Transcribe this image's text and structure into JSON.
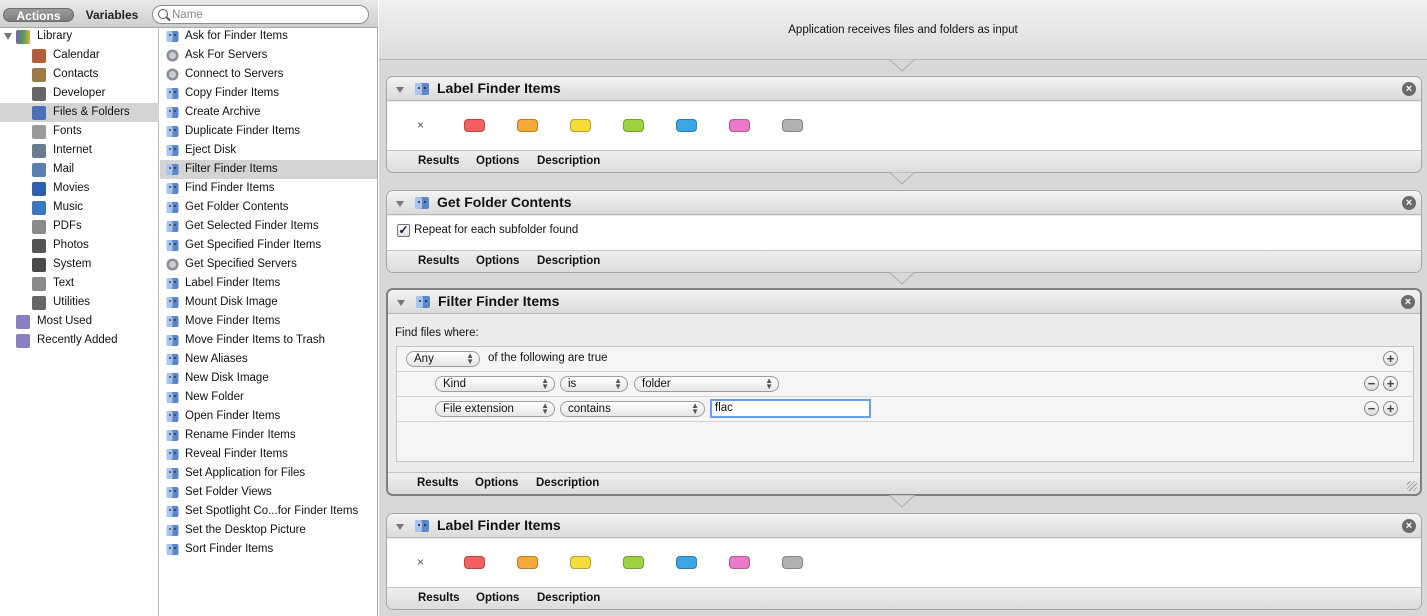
{
  "toolbar": {
    "actions_tab": "Actions",
    "variables_tab": "Variables",
    "search_placeholder": "Name"
  },
  "library": {
    "root": "Library",
    "items": [
      {
        "label": "Calendar",
        "icon": "calendar-icon",
        "color": "#b35f3a"
      },
      {
        "label": "Contacts",
        "icon": "contacts-icon",
        "color": "#9c7a4a"
      },
      {
        "label": "Developer",
        "icon": "tools-icon",
        "color": "#666666"
      },
      {
        "label": "Files & Folders",
        "icon": "finder-icon",
        "color": "#4a70b8"
      },
      {
        "label": "Fonts",
        "icon": "fonts-icon",
        "color": "#9a9a9a"
      },
      {
        "label": "Internet",
        "icon": "globe-icon",
        "color": "#6a7c90"
      },
      {
        "label": "Mail",
        "icon": "mail-icon",
        "color": "#5a7fb0"
      },
      {
        "label": "Movies",
        "icon": "quicktime-icon",
        "color": "#2f5fb0"
      },
      {
        "label": "Music",
        "icon": "itunes-icon",
        "color": "#3a76c4"
      },
      {
        "label": "PDFs",
        "icon": "pdf-icon",
        "color": "#8a8a8a"
      },
      {
        "label": "Photos",
        "icon": "camera-icon",
        "color": "#555555"
      },
      {
        "label": "System",
        "icon": "system-icon",
        "color": "#4a4a4a"
      },
      {
        "label": "Text",
        "icon": "text-icon",
        "color": "#8a8a8a"
      },
      {
        "label": "Utilities",
        "icon": "tools-icon",
        "color": "#666666"
      }
    ],
    "smart_groups": [
      {
        "label": "Most Used",
        "icon": "smart-folder-icon",
        "color": "#8b7fc4"
      },
      {
        "label": "Recently Added",
        "icon": "smart-folder-icon",
        "color": "#8b7fc4"
      }
    ],
    "selected": "Files & Folders"
  },
  "actions": [
    {
      "label": "Ask for Finder Items",
      "icon": "finder-icon"
    },
    {
      "label": "Ask For Servers",
      "icon": "server-icon"
    },
    {
      "label": "Connect to Servers",
      "icon": "server-icon"
    },
    {
      "label": "Copy Finder Items",
      "icon": "finder-icon"
    },
    {
      "label": "Create Archive",
      "icon": "finder-icon"
    },
    {
      "label": "Duplicate Finder Items",
      "icon": "finder-icon"
    },
    {
      "label": "Eject Disk",
      "icon": "finder-icon"
    },
    {
      "label": "Filter Finder Items",
      "icon": "finder-icon"
    },
    {
      "label": "Find Finder Items",
      "icon": "finder-icon"
    },
    {
      "label": "Get Folder Contents",
      "icon": "finder-icon"
    },
    {
      "label": "Get Selected Finder Items",
      "icon": "finder-icon"
    },
    {
      "label": "Get Specified Finder Items",
      "icon": "finder-icon"
    },
    {
      "label": "Get Specified Servers",
      "icon": "server-icon"
    },
    {
      "label": "Label Finder Items",
      "icon": "finder-icon"
    },
    {
      "label": "Mount Disk Image",
      "icon": "finder-icon"
    },
    {
      "label": "Move Finder Items",
      "icon": "finder-icon"
    },
    {
      "label": "Move Finder Items to Trash",
      "icon": "finder-icon"
    },
    {
      "label": "New Aliases",
      "icon": "finder-icon"
    },
    {
      "label": "New Disk Image",
      "icon": "finder-icon"
    },
    {
      "label": "New Folder",
      "icon": "finder-icon"
    },
    {
      "label": "Open Finder Items",
      "icon": "finder-icon"
    },
    {
      "label": "Rename Finder Items",
      "icon": "finder-icon"
    },
    {
      "label": "Reveal Finder Items",
      "icon": "finder-icon"
    },
    {
      "label": "Set Application for Files",
      "icon": "finder-icon"
    },
    {
      "label": "Set Folder Views",
      "icon": "finder-icon"
    },
    {
      "label": "Set Spotlight Co...for Finder Items",
      "icon": "finder-icon"
    },
    {
      "label": "Set the Desktop Picture",
      "icon": "finder-icon"
    },
    {
      "label": "Sort Finder Items",
      "icon": "finder-icon"
    }
  ],
  "selected_action": "Filter Finder Items",
  "workflow": {
    "input_text": "Application receives files and folders as input",
    "footer_tabs": {
      "results": "Results",
      "options": "Options",
      "description": "Description"
    },
    "label_colors": [
      "#f46060",
      "#f6a83a",
      "#f4dc3c",
      "#9ed23e",
      "#3ba6e6",
      "#ea7ac8",
      "#b1b1b1"
    ],
    "clear_label": "×",
    "blocks": {
      "label1": {
        "title": "Label Finder Items"
      },
      "getfolder": {
        "title": "Get Folder Contents",
        "checkbox_label": "Repeat for each subfolder found",
        "checked": true
      },
      "filter": {
        "title": "Filter Finder Items",
        "find_label": "Find files where:",
        "match_mode": "Any",
        "match_suffix": "of the following are true",
        "rows": [
          {
            "field": "Kind",
            "op": "is",
            "value": "folder"
          },
          {
            "field": "File extension",
            "op": "contains",
            "value": "flac"
          }
        ]
      },
      "label2": {
        "title": "Label Finder Items"
      }
    }
  }
}
